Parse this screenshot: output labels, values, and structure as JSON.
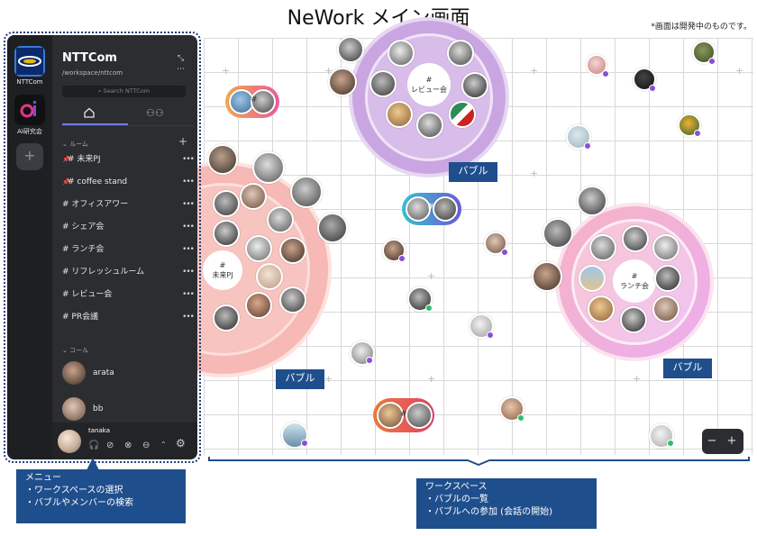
{
  "title": "NeWork メイン画面",
  "dev_note": "*画面は開発中のものです。",
  "menu": {
    "workspaces": [
      {
        "label": "NTTCom"
      },
      {
        "label": "AI研究会"
      }
    ],
    "add_workspace": "+",
    "org_name": "NTTCom",
    "org_path": "/workspace/nttcom",
    "search_placeholder": "Search NTTCom",
    "rooms_header": "ルーム",
    "rooms": [
      {
        "label": "# 未来PJ",
        "pinned": true
      },
      {
        "label": "# coffee stand",
        "pinned": true
      },
      {
        "label": "# オフィスアワー",
        "pinned": false
      },
      {
        "label": "# シェア会",
        "pinned": false
      },
      {
        "label": "# ランチ会",
        "pinned": false
      },
      {
        "label": "# リフレッシュルーム",
        "pinned": false
      },
      {
        "label": "# レビュー会",
        "pinned": false
      },
      {
        "label": "# PR会議",
        "pinned": false
      }
    ],
    "calls_header": "コール",
    "calls": [
      {
        "name": "arata"
      },
      {
        "name": "bb"
      }
    ],
    "me": {
      "name": "tanaka"
    }
  },
  "bubbles": [
    {
      "label_hash": "#",
      "label": "未来PJ"
    },
    {
      "label_hash": "#",
      "label": "レビュー会"
    },
    {
      "label_hash": "#",
      "label": "ランチ会"
    }
  ],
  "small_bubble_hash": "#",
  "callouts": {
    "bubble": "バブル"
  },
  "info_menu": {
    "title": "メニュー",
    "items": [
      "・ワークスペースの選択",
      "・バブルやメンバーの検索"
    ]
  },
  "info_workspace": {
    "title": "ワークスペース",
    "items": [
      "・バブルの一覧",
      "・バブルへの参加 (会話の開始)"
    ]
  },
  "zoom": {
    "minus": "−",
    "plus": "+"
  },
  "colors": {
    "menu_bg": "#2b2d31",
    "callout_bg": "#1f4e8c",
    "bubble_pink": "#f6b9b5",
    "bubble_purple": "#c9a6e2",
    "bubble_magenta": "#f2b0e8",
    "accent": "#6d7cff"
  }
}
